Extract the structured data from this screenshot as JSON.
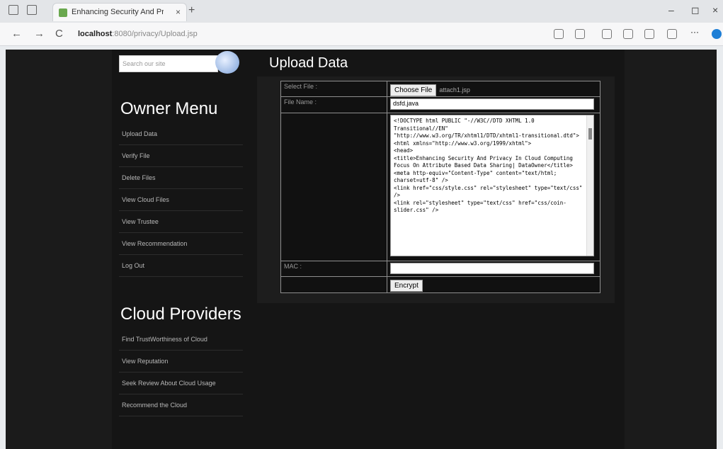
{
  "browser": {
    "tab_title": "Enhancing Security And Privacy",
    "close": "×",
    "new_tab": "+",
    "url_host": "localhost",
    "url_path": ":8080/privacy/Upload.jsp",
    "back": "←",
    "forward": "→",
    "reload": "C",
    "minimize": "–",
    "maximize": "◻",
    "window_close": "×"
  },
  "sidebar": {
    "search_placeholder": "Search our site",
    "owner_heading": "Owner Menu",
    "owner_items": [
      "Upload Data",
      "Verify File",
      "Delete Files",
      "View Cloud Files",
      "View Trustee",
      "View Recommendation",
      "Log Out"
    ],
    "cloud_heading": "Cloud Providers",
    "cloud_items": [
      "Find TrustWorthiness of Cloud",
      "View Reputation",
      "Seek Review About Cloud Usage",
      "Recommend the Cloud"
    ]
  },
  "main": {
    "title": "Upload Data",
    "select_label": "Select File :",
    "choose_button": "Choose File",
    "chosen_file": "attach1.jsp",
    "name_label": "File Name :",
    "name_value": "dsfd.java",
    "code_text": "<!DOCTYPE html PUBLIC \"-//W3C//DTD XHTML 1.0 Transitional//EN\"\n\"http://www.w3.org/TR/xhtml1/DTD/xhtml1-transitional.dtd\">\n<html xmlns=\"http://www.w3.org/1999/xhtml\">\n<head>\n<title>Enhancing Security And Privacy In Cloud Computing Focus On Attribute Based Data Sharing| DataOwner</title>\n<meta http-equiv=\"Content-Type\" content=\"text/html; charset=utf-8\" />\n<link href=\"css/style.css\" rel=\"stylesheet\" type=\"text/css\" />\n<link rel=\"stylesheet\" type=\"text/css\" href=\"css/coin-slider.css\" />",
    "mac_label": "MAC :",
    "mac_value": "",
    "encrypt_button": "Encrypt"
  }
}
